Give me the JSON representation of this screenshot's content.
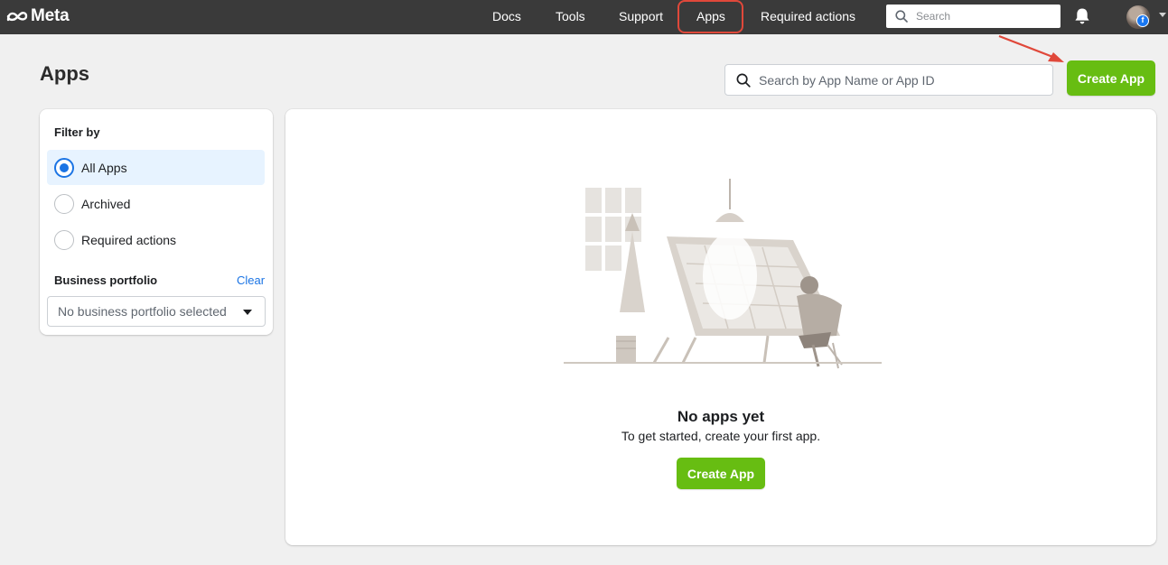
{
  "topnav": {
    "logo_text": "Meta",
    "links": [
      "Docs",
      "Tools",
      "Support",
      "Apps",
      "Required actions"
    ],
    "active_link": "Apps",
    "search_placeholder": "Search",
    "notification_icon": "bell-icon",
    "avatar_badge": "f"
  },
  "page": {
    "title": "Apps",
    "search_placeholder": "Search by App Name or App ID",
    "create_button": "Create App"
  },
  "sidebar": {
    "filter_title": "Filter by",
    "filters": [
      {
        "label": "All Apps",
        "selected": true
      },
      {
        "label": "Archived",
        "selected": false
      },
      {
        "label": "Required actions",
        "selected": false
      }
    ],
    "business_portfolio_title": "Business portfolio",
    "clear_label": "Clear",
    "portfolio_select_value": "No business portfolio selected"
  },
  "empty_state": {
    "title": "No apps yet",
    "subtitle": "To get started, create your first app.",
    "button": "Create App"
  },
  "colors": {
    "topbar": "#3a3a3a",
    "accent_green": "#67bd12",
    "accent_blue": "#1b74e4",
    "highlight_red": "#e0483a"
  }
}
